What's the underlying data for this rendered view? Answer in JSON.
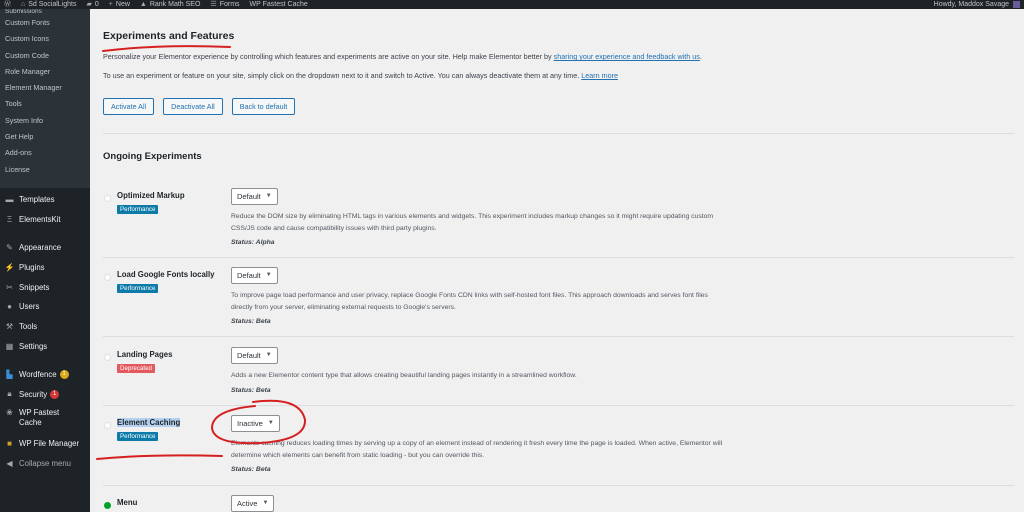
{
  "adminbar": {
    "site_name": "Sd SocialLights",
    "comments_count": "0",
    "new_label": "New",
    "rankmath_label": "Rank Math SEO",
    "forms_label": "Forms",
    "wpfc_label": "WP Fastest Cache",
    "greeting": "Howdy, Maddox Savage"
  },
  "sidebar": {
    "submenu": [
      "Submissions",
      "Custom Fonts",
      "Custom Icons",
      "Custom Code",
      "Role Manager",
      "Element Manager",
      "Tools",
      "System Info",
      "Get Help",
      "Add-ons",
      "License"
    ],
    "menu": [
      {
        "label": "Templates",
        "icon": "folder-icon"
      },
      {
        "label": "ElementsKit",
        "icon": "elementskit-icon"
      },
      {
        "label": "Appearance",
        "icon": "paintbrush-icon"
      },
      {
        "label": "Plugins",
        "icon": "plugin-icon"
      },
      {
        "label": "Snippets",
        "icon": "scissors-icon"
      },
      {
        "label": "Users",
        "icon": "user-icon"
      },
      {
        "label": "Tools",
        "icon": "wrench-icon"
      },
      {
        "label": "Settings",
        "icon": "settings-icon"
      },
      {
        "label": "Wordfence",
        "icon": "wordfence-icon",
        "badge": "1"
      },
      {
        "label": "Security",
        "icon": "lock-icon",
        "badge": "1"
      },
      {
        "label": "WP Fastest Cache",
        "icon": "cheetah-icon"
      },
      {
        "label": "WP File Manager",
        "icon": "folder-file-icon"
      },
      {
        "label": "Collapse menu",
        "icon": "collapse-icon"
      }
    ]
  },
  "main": {
    "title": "Experiments and Features",
    "intro1_prefix": "Personalize your Elementor experience by controlling which features and experiments are active on your site. Help make Elementor better by ",
    "intro1_link": "sharing your experience and feedback with us",
    "intro1_suffix": ".",
    "intro2_prefix": "To use an experiment or feature on your site, simply click on the dropdown next to it and switch to Active. You can always deactivate them at any time. ",
    "intro2_link": "Learn more",
    "buttons": {
      "activate_all": "Activate All",
      "deactivate_all": "Deactivate All",
      "back_to_default": "Back to default"
    },
    "section_title": "Ongoing Experiments",
    "experiments": [
      {
        "name": "Optimized Markup",
        "tag": "Performance",
        "state": "Default",
        "description": "Reduce the DOM size by eliminating HTML tags in various elements and widgets. This experiment includes markup changes so it might require updating custom CSS/JS code and cause compatibility issues with third party plugins.",
        "status": "Status: Alpha"
      },
      {
        "name": "Load Google Fonts locally",
        "tag": "Performance",
        "state": "Default",
        "description": "To improve page load performance and user privacy, replace Google Fonts CDN links with self-hosted font files. This approach downloads and serves font files directly from your server, eliminating external requests to Google's servers.",
        "status": "Status: Beta"
      },
      {
        "name": "Landing Pages",
        "tag": "Deprecated",
        "state": "Default",
        "description": "Adds a new Elementor content type that allows creating beautiful landing pages instantly in a streamlined workflow.",
        "status": "Status: Beta"
      },
      {
        "name": "Element Caching",
        "tag": "Performance",
        "state": "Inactive",
        "description": "Elements caching reduces loading times by serving up a copy of an element instead of rendering it fresh every time the page is loaded. When active, Elementor will determine which elements can benefit from static loading - but you can override this.",
        "status": "Status: Beta"
      },
      {
        "name": "Menu",
        "tag": "",
        "state": "Active",
        "description": "",
        "status": ""
      }
    ]
  },
  "colors": {
    "adminbar_bg": "#1d2327",
    "sidebar_bg": "#1d2327",
    "link": "#2271b1",
    "performance_tag": "#0d7aa7",
    "deprecated_tag": "#e35a5e",
    "active_dot": "#00a32a",
    "annotation": "#d62020"
  }
}
